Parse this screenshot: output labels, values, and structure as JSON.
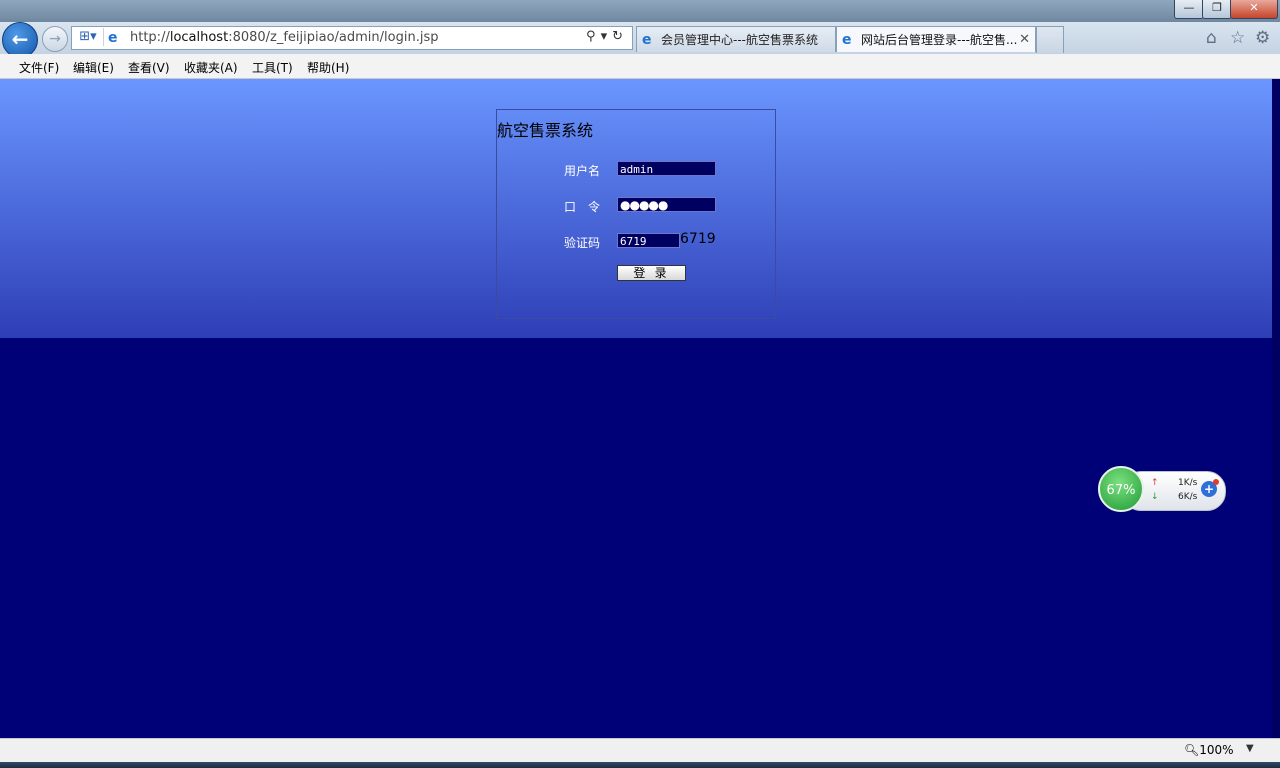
{
  "window": {
    "minimize_label": "—",
    "restore_label": "❐",
    "close_label": "✕"
  },
  "navbar": {
    "back_icon": "back-arrow-icon",
    "forward_icon": "forward-arrow-icon",
    "address": {
      "prefix": "http://",
      "host": "localhost",
      "rest": ":8080/z_feijipiao/admin/login.jsp"
    },
    "tabs": [
      {
        "label": "会员管理中心---航空售票系统",
        "active": false
      },
      {
        "label": "网站后台管理登录---航空售...",
        "active": true
      }
    ],
    "right_icons": [
      "home-icon",
      "star-icon",
      "gear-icon"
    ]
  },
  "menu": {
    "items": [
      "文件(F)",
      "编辑(E)",
      "查看(V)",
      "收藏夹(A)",
      "工具(T)",
      "帮助(H)"
    ]
  },
  "login": {
    "title": "航空售票系统",
    "username_label": "用户名",
    "username_value": "admin",
    "password_label": "口　令",
    "password_value": "●●●●●",
    "captcha_label": "验证码",
    "captcha_value": "6719",
    "captcha_text": "6719",
    "submit_label": "登 录"
  },
  "netwidget": {
    "percent": "67%",
    "upload": "1K/s",
    "download": "6K/s"
  },
  "statusbar": {
    "zoom": "100%"
  }
}
